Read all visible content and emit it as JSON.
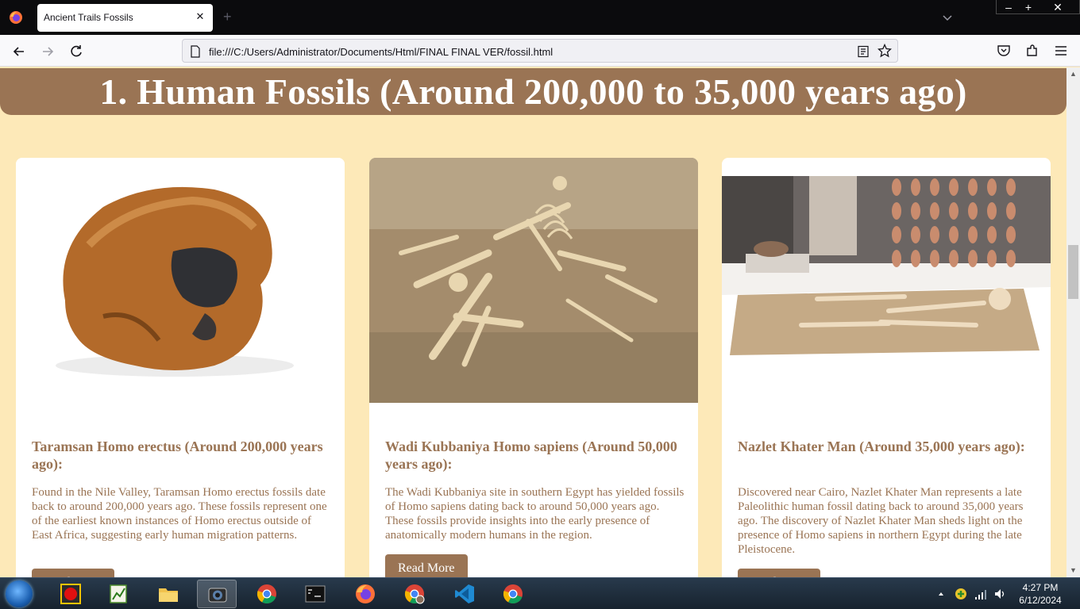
{
  "browser": {
    "tab_title": "Ancient Trails Fossils",
    "url": "file:///C:/Users/Administrator/Documents/Html/FINAL FINAL VER/fossil.html",
    "new_tab_symbol": "+",
    "close_symbol": "✕",
    "window_controls": {
      "minimize": "–",
      "maximize": "+",
      "close": "✕"
    }
  },
  "page": {
    "heading": "1. Human Fossils (Around 200,000 to 35,000 years ago)",
    "cards": [
      {
        "title": "Taramsan Homo erectus (Around 200,000 years ago):",
        "text": "Found in the Nile Valley, Taramsan Homo erectus fossils date back to around 200,000 years ago. These fossils represent one of the earliest known instances of Homo erectus outside of East Africa, suggesting early human migration patterns.",
        "button": "Read More",
        "image_icon": "skull-photo"
      },
      {
        "title": "Wadi Kubbaniya Homo sapiens (Around 50,000 years ago):",
        "text": "The Wadi Kubbaniya site in southern Egypt has yielded fossils of Homo sapiens dating back to around 50,000 years ago. These fossils provide insights into the early presence of anatomically modern humans in the region.",
        "button": "Read More",
        "image_icon": "skeleton-in-sand-photo"
      },
      {
        "title": "Nazlet Khater Man (Around 35,000 years ago):",
        "text": "Discovered near Cairo, Nazlet Khater Man represents a late Paleolithic human fossil dating back to around 35,000 years ago. The discovery of Nazlet Khater Man sheds light on the presence of Homo sapiens in northern Egypt during the late Pleistocene.",
        "button": "Read More",
        "image_icon": "museum-skeleton-display-photo"
      }
    ]
  },
  "taskbar": {
    "apps": [
      "record-app",
      "chart-app",
      "file-explorer",
      "camera-app",
      "chrome",
      "terminal",
      "firefox",
      "chrome-profile",
      "vscode",
      "chrome"
    ],
    "time": "4:27 PM",
    "date": "6/12/2024"
  },
  "colors": {
    "page_background": "#fde9b8",
    "accent_brown": "#9a7454",
    "card_background": "#ffffff"
  }
}
